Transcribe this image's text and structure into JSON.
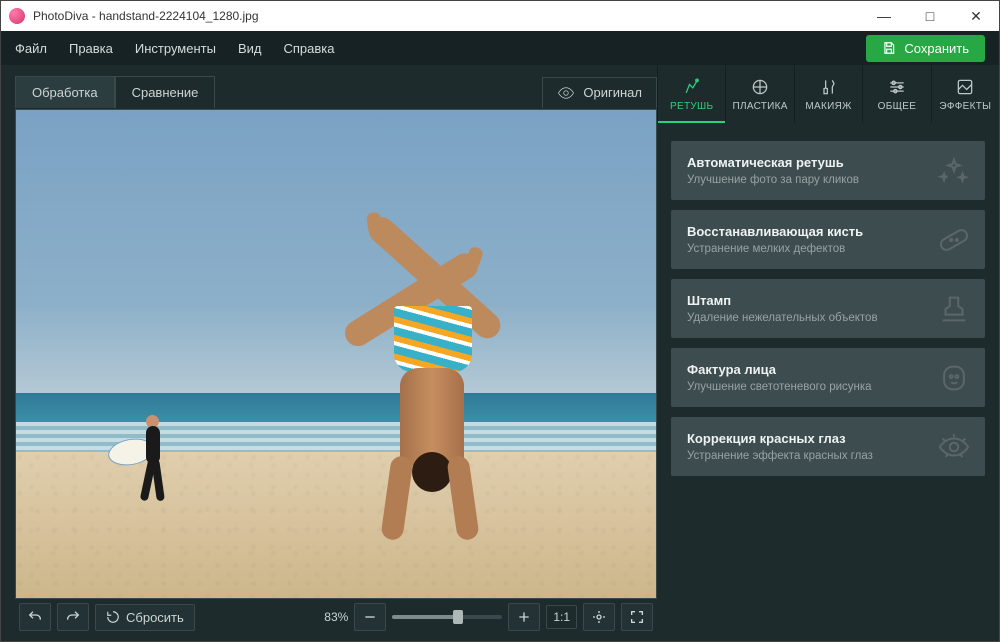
{
  "titlebar": {
    "title": "PhotoDiva - handstand-2224104_1280.jpg"
  },
  "menubar": {
    "items": [
      "Файл",
      "Правка",
      "Инструменты",
      "Вид",
      "Справка"
    ],
    "save": "Сохранить"
  },
  "viewTabs": {
    "tabs": [
      "Обработка",
      "Сравнение"
    ],
    "activeIndex": 0,
    "original": "Оригинал"
  },
  "zoom": {
    "percentText": "83%",
    "ratio": "1:1"
  },
  "bottomBar": {
    "reset": "Сбросить"
  },
  "toolTabs": {
    "items": [
      "РЕТУШЬ",
      "ПЛАСТИКА",
      "МАКИЯЖ",
      "ОБЩЕЕ",
      "ЭФФЕКТЫ"
    ],
    "activeIndex": 0
  },
  "tools": [
    {
      "title": "Автоматическая ретушь",
      "desc": "Улучшение фото за пару кликов"
    },
    {
      "title": "Восстанавливающая кисть",
      "desc": "Устранение мелких дефектов"
    },
    {
      "title": "Штамп",
      "desc": "Удаление нежелательных объектов"
    },
    {
      "title": "Фактура лица",
      "desc": "Улучшение светотеневого рисунка"
    },
    {
      "title": "Коррекция красных глаз",
      "desc": "Устранение эффекта красных глаз"
    }
  ]
}
